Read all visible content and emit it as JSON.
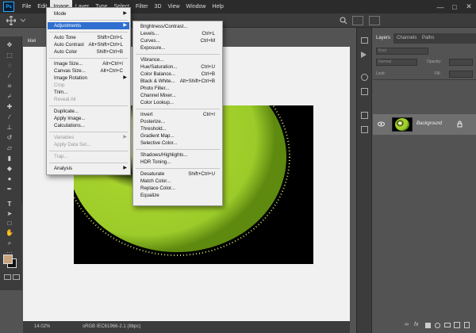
{
  "menubar": {
    "logo": "Ps",
    "items": [
      "File",
      "Edit",
      "Image",
      "Layer",
      "Type",
      "Select",
      "Filter",
      "3D",
      "View",
      "Window",
      "Help"
    ],
    "minimize": "—",
    "maximize": "□",
    "close": "✕"
  },
  "document": {
    "tab_label": "kiwi",
    "zoom": "14.02%",
    "doc_info": "sRGB IEC61966-2.1 (8bpc)"
  },
  "layers_panel": {
    "tabs": [
      "Layers",
      "Channels",
      "Paths"
    ],
    "search_placeholder": "Kind",
    "blend_mode": "Normal",
    "opacity_label": "Opacity:",
    "lock_label": "Lock:",
    "fill_label": "Fill:",
    "layer_name": "Background"
  },
  "image_menu": {
    "items": [
      {
        "label": "Mode",
        "submenu": true
      },
      {
        "label": "Adjustments",
        "submenu": true,
        "highlight": true
      },
      {
        "label": "Auto Tone",
        "shortcut": "Shift+Ctrl+L"
      },
      {
        "label": "Auto Contrast",
        "shortcut": "Alt+Shift+Ctrl+L"
      },
      {
        "label": "Auto Color",
        "shortcut": "Shift+Ctrl+B"
      },
      {
        "label": "Image Size...",
        "shortcut": "Alt+Ctrl+I"
      },
      {
        "label": "Canvas Size...",
        "shortcut": "Alt+Ctrl+C"
      },
      {
        "label": "Image Rotation",
        "submenu": true
      },
      {
        "label": "Crop",
        "disabled": true
      },
      {
        "label": "Trim..."
      },
      {
        "label": "Reveal All",
        "disabled": true
      },
      {
        "label": "Duplicate..."
      },
      {
        "label": "Apply Image..."
      },
      {
        "label": "Calculations..."
      },
      {
        "label": "Variables",
        "submenu": true,
        "disabled": true
      },
      {
        "label": "Apply Data Set...",
        "disabled": true
      },
      {
        "label": "Trap...",
        "disabled": true
      },
      {
        "label": "Analysis",
        "submenu": true
      }
    ]
  },
  "adjustments_menu": {
    "items": [
      {
        "label": "Brightness/Contrast..."
      },
      {
        "label": "Levels...",
        "shortcut": "Ctrl+L"
      },
      {
        "label": "Curves...",
        "shortcut": "Ctrl+M"
      },
      {
        "label": "Exposure..."
      },
      {
        "label": "Vibrance..."
      },
      {
        "label": "Hue/Saturation...",
        "shortcut": "Ctrl+U"
      },
      {
        "label": "Color Balance...",
        "shortcut": "Ctrl+B"
      },
      {
        "label": "Black & White...",
        "shortcut": "Alt+Shift+Ctrl+B"
      },
      {
        "label": "Photo Filter..."
      },
      {
        "label": "Channel Mixer..."
      },
      {
        "label": "Color Lookup..."
      },
      {
        "label": "Invert",
        "shortcut": "Ctrl+I"
      },
      {
        "label": "Posterize..."
      },
      {
        "label": "Threshold..."
      },
      {
        "label": "Gradient Map..."
      },
      {
        "label": "Selective Color..."
      },
      {
        "label": "Shadows/Highlights..."
      },
      {
        "label": "HDR Toning..."
      },
      {
        "label": "Desaturate",
        "shortcut": "Shift+Ctrl+U"
      },
      {
        "label": "Match Color..."
      },
      {
        "label": "Replace Color..."
      },
      {
        "label": "Equalize"
      }
    ]
  },
  "colors": {
    "menu_highlight": "#2f6fcf",
    "foreground_swatch": "#c9a27e",
    "background_swatch": "#111111",
    "kiwi_flesh": "#9ccc2a",
    "kiwi_core": "#dff0a8"
  },
  "icons": [
    "move-tool-icon",
    "marquee-tool-icon",
    "lasso-tool-icon",
    "magic-wand-tool-icon",
    "crop-tool-icon",
    "eyedropper-tool-icon",
    "healing-brush-tool-icon",
    "brush-tool-icon",
    "clone-stamp-tool-icon",
    "history-brush-tool-icon",
    "eraser-tool-icon",
    "gradient-tool-icon",
    "blur-tool-icon",
    "dodge-tool-icon",
    "pen-tool-icon",
    "type-tool-icon",
    "path-selection-tool-icon",
    "rectangle-tool-icon",
    "hand-tool-icon",
    "zoom-tool-icon",
    "eye-icon",
    "lock-icon"
  ]
}
